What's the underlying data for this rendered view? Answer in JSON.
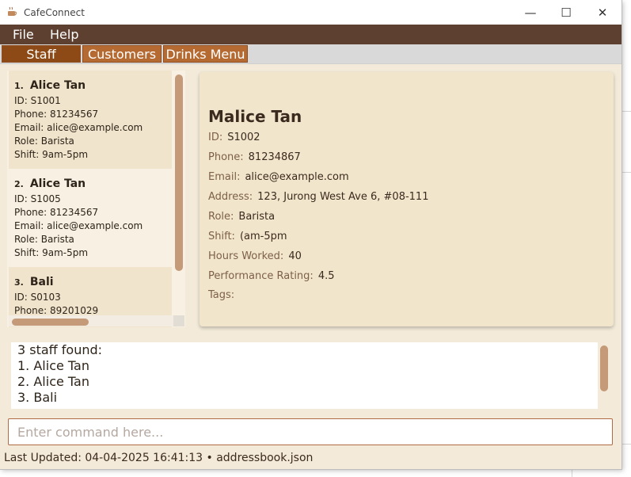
{
  "window": {
    "title": "CafeConnect",
    "controls": {
      "minimize": "—",
      "maximize": "☐",
      "close": "✕"
    }
  },
  "menu": [
    "File",
    "Help"
  ],
  "tabs": [
    {
      "label": "Staff",
      "active": true
    },
    {
      "label": "Customers",
      "active": false
    },
    {
      "label": "Drinks Menu",
      "active": false
    }
  ],
  "staff_list": [
    {
      "index": "1.",
      "name": "Alice Tan",
      "lines": [
        "ID: S1001",
        "Phone: 81234567",
        "Email: alice@example.com",
        "Role: Barista",
        "Shift: 9am-5pm"
      ]
    },
    {
      "index": "2.",
      "name": "Alice Tan",
      "lines": [
        "ID: S1005",
        "Phone: 81234567",
        "Email: alice@example.com",
        "Role: Barista",
        "Shift: 9am-5pm"
      ]
    },
    {
      "index": "3.",
      "name": "Bali",
      "lines": [
        "ID: S0103",
        "Phone: 89201029"
      ]
    }
  ],
  "detail": {
    "name": "Malice Tan",
    "fields": [
      {
        "label": "ID:",
        "value": "S1002"
      },
      {
        "label": "Phone:",
        "value": "81234867"
      },
      {
        "label": "Email:",
        "value": "alice@example.com"
      },
      {
        "label": "Address:",
        "value": "123, Jurong West Ave 6, #08-111"
      },
      {
        "label": "Role:",
        "value": "Barista"
      },
      {
        "label": "Shift:",
        "value": "(am-5pm"
      },
      {
        "label": "Hours Worked:",
        "value": "40"
      },
      {
        "label": "Performance Rating:",
        "value": "4.5"
      },
      {
        "label": "Tags:",
        "value": ""
      }
    ]
  },
  "result_lines": [
    "3 staff found:",
    "1. Alice Tan",
    "2. Alice Tan",
    "3. Bali"
  ],
  "command": {
    "placeholder": "Enter command here...",
    "value": ""
  },
  "status": "Last Updated: 04-04-2025 16:41:13 • addressbook.json",
  "colors": {
    "menubar": "#5d4030",
    "tab": "#b56a32",
    "tab_active": "#8e4a16",
    "accent": "#c49a78",
    "panel": "#f1e5cc"
  }
}
